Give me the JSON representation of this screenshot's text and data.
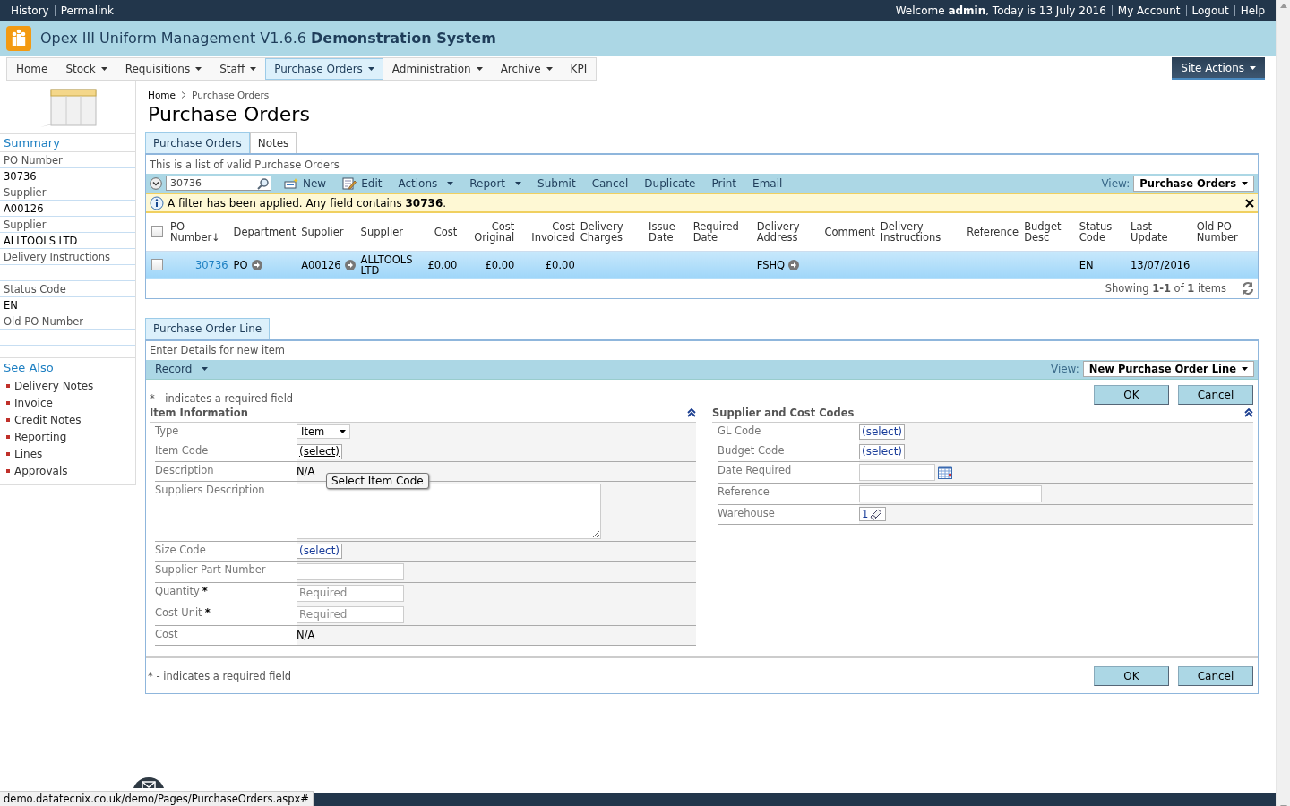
{
  "top_bar": {
    "left_links": [
      "History",
      "Permalink"
    ],
    "welcome": "Welcome **admin**, Today is 13 July 2016",
    "right_links": [
      "My Account",
      "Logout",
      "Help"
    ]
  },
  "header": {
    "title": "Opex III Uniform Management V1.6.6 **Demonstration System**"
  },
  "nav": {
    "items": [
      {
        "label": "Home",
        "dropdown": false,
        "selected": false
      },
      {
        "label": "Stock",
        "dropdown": true,
        "selected": false
      },
      {
        "label": "Requisitions",
        "dropdown": true,
        "selected": false
      },
      {
        "label": "Staff",
        "dropdown": true,
        "selected": false
      },
      {
        "label": "Purchase Orders",
        "dropdown": true,
        "selected": true
      },
      {
        "label": "Administration",
        "dropdown": true,
        "selected": false
      },
      {
        "label": "Archive",
        "dropdown": true,
        "selected": false
      },
      {
        "label": "KPI",
        "dropdown": false,
        "selected": false
      }
    ],
    "site_actions": "Site Actions"
  },
  "breadcrumb": [
    "Home",
    "Purchase Orders"
  ],
  "page_title": "Purchase Orders",
  "sidebar": {
    "summary_title": "Summary",
    "fields": [
      {
        "label": "PO Number",
        "value": "30736"
      },
      {
        "label": "Supplier",
        "value": "A00126"
      },
      {
        "label": "Supplier",
        "value": "ALLTOOLS LTD"
      },
      {
        "label": "Delivery Instructions"
      },
      {
        "label": "Status Code",
        "value": "EN"
      },
      {
        "label": "Old PO Number"
      }
    ],
    "see_also_title": "See Also",
    "links": [
      "Delivery Notes",
      "Invoice",
      "Credit Notes",
      "Reporting",
      "Lines",
      "Approvals"
    ]
  },
  "list_panel": {
    "tabs": [
      {
        "label": "Purchase Orders",
        "selected": true
      },
      {
        "label": "Notes",
        "selected": false
      }
    ],
    "description": "This is a list of valid Purchase Orders",
    "search": {
      "value": "30736"
    },
    "toolbar": [
      {
        "label": "New",
        "kind": "new"
      },
      {
        "label": "Edit",
        "kind": "edit"
      },
      {
        "label": "Actions",
        "kind": "menu"
      },
      {
        "label": "Report",
        "kind": "menu"
      },
      {
        "label": "Submit",
        "kind": "plain"
      },
      {
        "label": "Cancel",
        "kind": "plain"
      },
      {
        "label": "Duplicate",
        "kind": "plain"
      },
      {
        "label": "Print",
        "kind": "plain"
      },
      {
        "label": "Email",
        "kind": "plain"
      }
    ],
    "view_label": "View:",
    "view_value": "Purchase Orders",
    "filter_message": "A filter has been applied. Any field contains **30736**.",
    "columns": [
      "PO Number↓",
      "Department",
      "Supplier",
      "Supplier",
      "Cost",
      "Cost Original",
      "Cost Invoiced",
      "Delivery Charges",
      "Issue Date",
      "Required Date",
      "Delivery Address",
      "Comment",
      "Delivery Instructions",
      "Reference",
      "Budget Desc",
      "Status Code",
      "Last Update",
      "Old PO Number"
    ],
    "select_all_checked": false,
    "rows": [
      {
        "selected": true,
        "checked": false,
        "cells": [
          {
            "text": "30736",
            "kind": "link"
          },
          {
            "text": "PO",
            "kind": "arrow"
          },
          {
            "text": "A00126",
            "kind": "arrow"
          },
          {
            "text": "ALLTOOLS LTD",
            "kind": "plain"
          },
          {
            "text": "£0.00",
            "kind": "plain"
          },
          {
            "text": "£0.00",
            "kind": "plain"
          },
          {
            "text": "£0.00",
            "kind": "plain"
          },
          {},
          {},
          {},
          {
            "text": "FSHQ",
            "kind": "arrow"
          },
          {},
          {},
          {},
          {},
          {
            "text": "EN",
            "kind": "plain"
          },
          {
            "text": "13/07/2016",
            "kind": "plain"
          },
          {}
        ]
      }
    ],
    "footer": "Showing **1-1** of **1** items"
  },
  "line_panel": {
    "tabs": [
      {
        "label": "Purchase Order Line",
        "selected": true
      }
    ],
    "description": "Enter Details for new item",
    "record_menu": "Record",
    "view_label": "View:",
    "view_value": "New Purchase Order Line",
    "required_note": "* - indicates a required field",
    "buttons": [
      "OK",
      "Cancel"
    ],
    "sections": [
      {
        "title": "Item Information",
        "fields": [
          {
            "label": "Type",
            "kind": "select",
            "value": "Item"
          },
          {
            "label": "Item Code",
            "kind": "picker",
            "value": "(select)",
            "focused": true,
            "tooltip": "Select Item Code"
          },
          {
            "label": "Description",
            "kind": "text",
            "value": "N/A"
          },
          {
            "label": "Suppliers Description",
            "kind": "textarea"
          },
          {
            "label": "Size Code",
            "kind": "picker",
            "value": "(select)",
            "focused": false
          },
          {
            "label": "Supplier Part Number",
            "kind": "input"
          },
          {
            "label": "Quantity",
            "kind": "input",
            "placeholder": "Required",
            "required_mark": "*"
          },
          {
            "label": "Cost Unit",
            "kind": "input",
            "placeholder": "Required",
            "required_mark": "*"
          },
          {
            "label": "Cost",
            "kind": "text",
            "value": "N/A"
          }
        ]
      },
      {
        "title": "Supplier and Cost Codes",
        "fields": [
          {
            "label": "GL Code",
            "kind": "picker",
            "value": "(select)",
            "focused": false
          },
          {
            "label": "Budget Code",
            "kind": "picker",
            "value": "(select)",
            "focused": false
          },
          {
            "label": "Date Required",
            "kind": "date"
          },
          {
            "label": "Reference",
            "kind": "long_input"
          },
          {
            "label": "Warehouse",
            "kind": "lookup",
            "value": "1"
          }
        ]
      }
    ],
    "bottom_note": "* - indicates a required field",
    "bottom_buttons": [
      "OK",
      "Cancel"
    ]
  },
  "status_url": "demo.datatecnix.co.uk/demo/Pages/PurchaseOrders.aspx#"
}
